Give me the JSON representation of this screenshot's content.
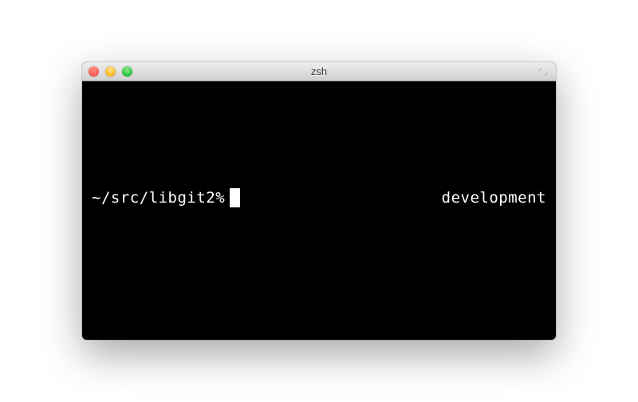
{
  "window": {
    "title": "zsh"
  },
  "terminal": {
    "prompt_left": "~/src/libgit2%",
    "prompt_right": "development"
  }
}
